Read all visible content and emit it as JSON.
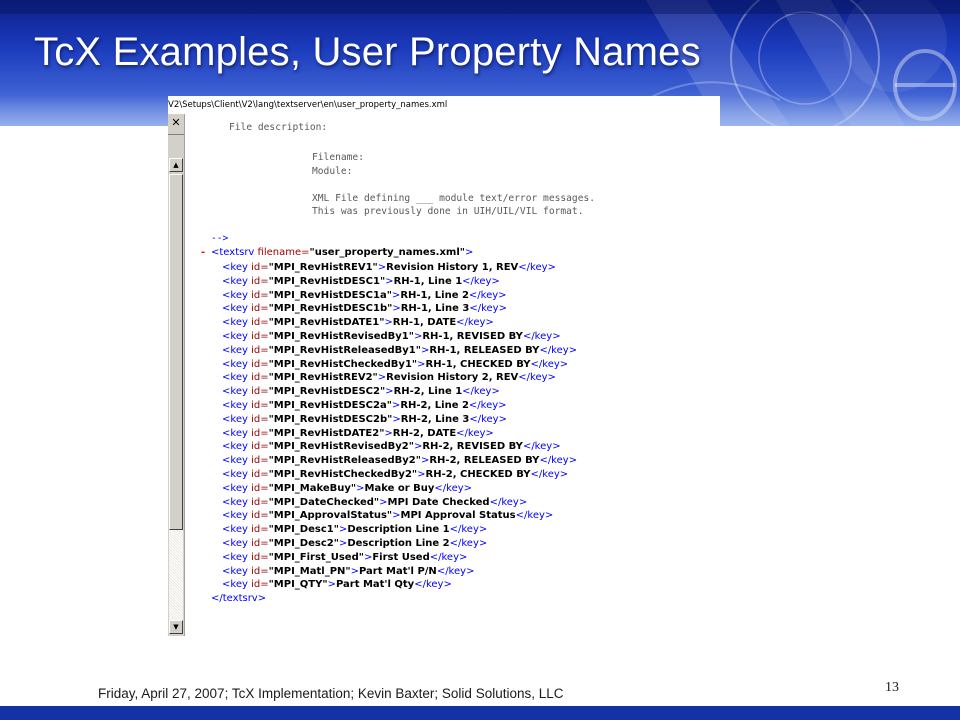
{
  "slide": {
    "title": "TcX Examples, User Property Names",
    "footer": "Friday, April 27, 2007; TcX Implementation; Kevin Baxter; Solid Solutions, LLC",
    "page_number": "13"
  },
  "window": {
    "path": "V2\\Setups\\Client\\V2\\lang\\textserver\\en\\user_property_names.xml",
    "close_glyph": "✕",
    "scroll_up_glyph": "▲",
    "scroll_down_glyph": "▼",
    "comment_lines": [
      "File description:",
      "Filename:",
      "Module:",
      "XML File defining ___ module text/error messages.",
      "This was previously done in UIH/UIL/VIL format."
    ],
    "comment_end": "-->",
    "collapse_marker": "-",
    "root": {
      "open_tag": "<textsrv",
      "attr_name": " filename=",
      "attr_value": "\"user_property_names.xml\"",
      "open_close": ">",
      "close_tag": "</textsrv>"
    },
    "key_markup": {
      "open": "<key",
      "attr": " id=",
      "gt": ">",
      "close": "</key>"
    },
    "keys": [
      {
        "id": "\"MPI_RevHistREV1\"",
        "text": "Revision History 1, REV"
      },
      {
        "id": "\"MPI_RevHistDESC1\"",
        "text": "RH-1, Line 1"
      },
      {
        "id": "\"MPI_RevHistDESC1a\"",
        "text": "RH-1, Line 2"
      },
      {
        "id": "\"MPI_RevHistDESC1b\"",
        "text": "RH-1, Line 3"
      },
      {
        "id": "\"MPI_RevHistDATE1\"",
        "text": "RH-1, DATE"
      },
      {
        "id": "\"MPI_RevHistRevisedBy1\"",
        "text": "RH-1, REVISED BY"
      },
      {
        "id": "\"MPI_RevHistReleasedBy1\"",
        "text": "RH-1, RELEASED BY"
      },
      {
        "id": "\"MPI_RevHistCheckedBy1\"",
        "text": "RH-1, CHECKED BY"
      },
      {
        "id": "\"MPI_RevHistREV2\"",
        "text": "Revision History 2, REV"
      },
      {
        "id": "\"MPI_RevHistDESC2\"",
        "text": "RH-2, Line 1"
      },
      {
        "id": "\"MPI_RevHistDESC2a\"",
        "text": "RH-2, Line 2"
      },
      {
        "id": "\"MPI_RevHistDESC2b\"",
        "text": "RH-2, Line 3"
      },
      {
        "id": "\"MPI_RevHistDATE2\"",
        "text": "RH-2, DATE"
      },
      {
        "id": "\"MPI_RevHistRevisedBy2\"",
        "text": "RH-2, REVISED BY"
      },
      {
        "id": "\"MPI_RevHistReleasedBy2\"",
        "text": "RH-2, RELEASED BY"
      },
      {
        "id": "\"MPI_RevHistCheckedBy2\"",
        "text": "RH-2, CHECKED BY"
      },
      {
        "id": "\"MPI_MakeBuy\"",
        "text": "Make or Buy"
      },
      {
        "id": "\"MPI_DateChecked\"",
        "text": "MPI Date Checked"
      },
      {
        "id": "\"MPI_ApprovalStatus\"",
        "text": "MPI Approval Status"
      },
      {
        "id": "\"MPI_Desc1\"",
        "text": "Description Line 1"
      },
      {
        "id": "\"MPI_Desc2\"",
        "text": "Description Line 2"
      },
      {
        "id": "\"MPI_First_Used\"",
        "text": "First Used"
      },
      {
        "id": "\"MPI_Matl_PN\"",
        "text": "Part Mat'l P/N"
      },
      {
        "id": "\"MPI_QTY\"",
        "text": "Part Mat'l Qty"
      }
    ]
  },
  "colors": {
    "header_dark": "#0c1f86",
    "header_mid": "#1b3bbd",
    "bottom_bar": "#1432a6",
    "xml_tag": "#0000ff",
    "xml_attr_name": "#990000",
    "collapse_marker": "#ff0000"
  }
}
